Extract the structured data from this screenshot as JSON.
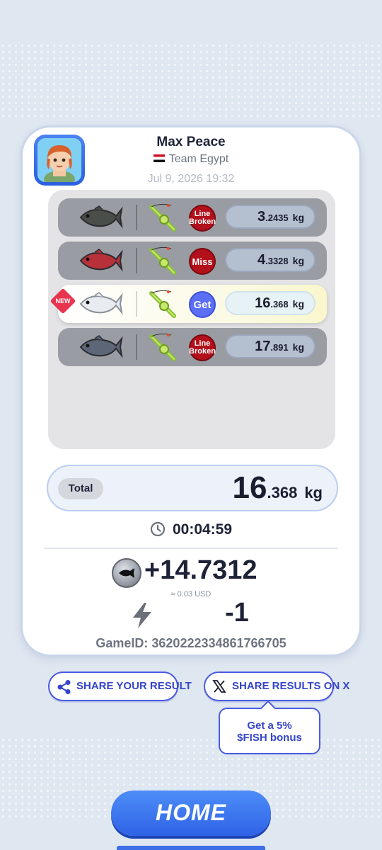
{
  "player": {
    "name": "Max Peace",
    "team": "Team Egypt",
    "date": "Jul 9, 2026 19:32"
  },
  "catches": [
    {
      "result": "Line Broken",
      "badge_line1": "Line",
      "badge_line2": "Broken",
      "weight_int": "3",
      "weight_dec": ".2435",
      "unit": "kg",
      "fish_color": "#4a4e48",
      "highlight": false
    },
    {
      "result": "Miss",
      "badge_line1": "Miss",
      "badge_line2": "",
      "weight_int": "4",
      "weight_dec": ".3328",
      "unit": "kg",
      "fish_color": "#b8313a",
      "highlight": false
    },
    {
      "result": "Get",
      "badge_line1": "Get",
      "badge_line2": "",
      "weight_int": "16",
      "weight_dec": ".368",
      "unit": "kg",
      "fish_color": "#e8ebf0",
      "highlight": true,
      "tag": "NEW"
    },
    {
      "result": "Line Broken",
      "badge_line1": "Line",
      "badge_line2": "Broken",
      "weight_int": "17",
      "weight_dec": ".891",
      "unit": "kg",
      "fish_color": "#5c6677",
      "highlight": false
    }
  ],
  "total": {
    "label": "Total",
    "int": "16",
    "dec": ".368",
    "unit": "kg"
  },
  "timer": "00:04:59",
  "reward": {
    "value": "+14.7312",
    "usd": "≈ 0.03 USD"
  },
  "energy": {
    "value": "-1"
  },
  "game_id": "GameID: 3620222334861766705",
  "buttons": {
    "share_result": "SHARE YOUR RESULT",
    "share_x": "SHARE RESULTS ON X",
    "home": "HOME"
  },
  "tooltip": {
    "line1": "Get a 5%",
    "line2": "$FISH bonus"
  },
  "colors": {
    "accent": "#3545c8",
    "fail": "#b2101a",
    "success": "#5a6ff5",
    "home": "#2f63e6"
  }
}
